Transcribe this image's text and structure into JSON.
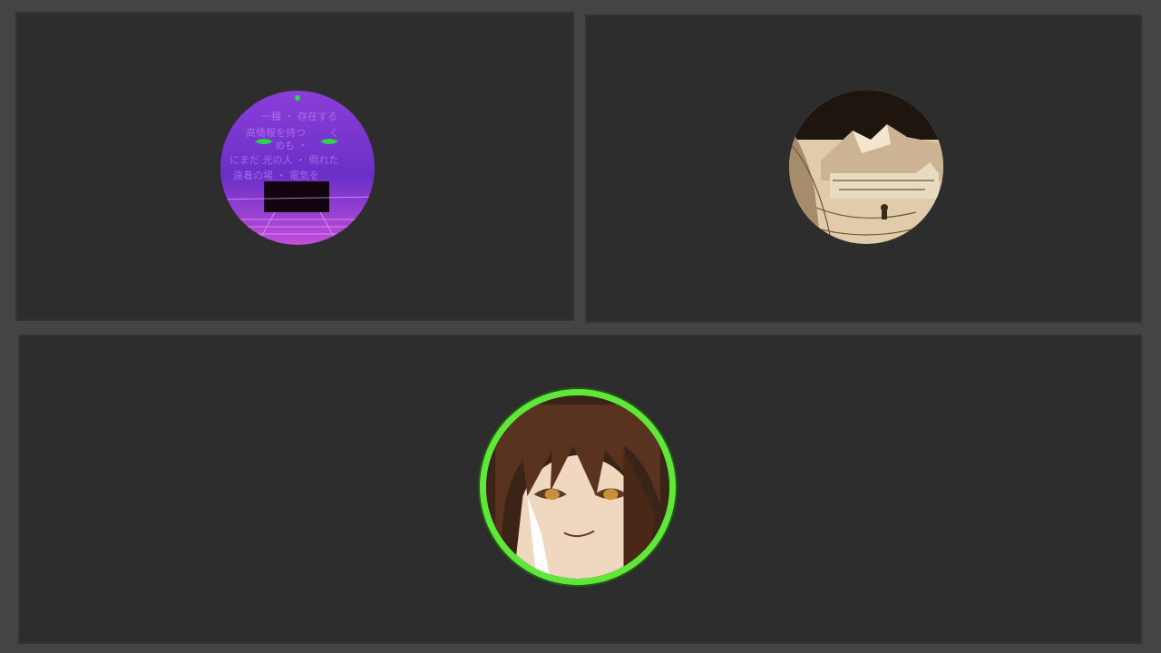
{
  "call": {
    "participants": [
      {
        "avatar": "vaporwave-face-avatar",
        "speaking": false
      },
      {
        "avatar": "snowy-landscape-avatar",
        "speaking": false
      },
      {
        "avatar": "anime-girl-avatar",
        "speaking": true
      }
    ]
  },
  "colors": {
    "background": "#444444",
    "tile": "#2d2d2d",
    "speaking_ring": "#5fe83a"
  }
}
